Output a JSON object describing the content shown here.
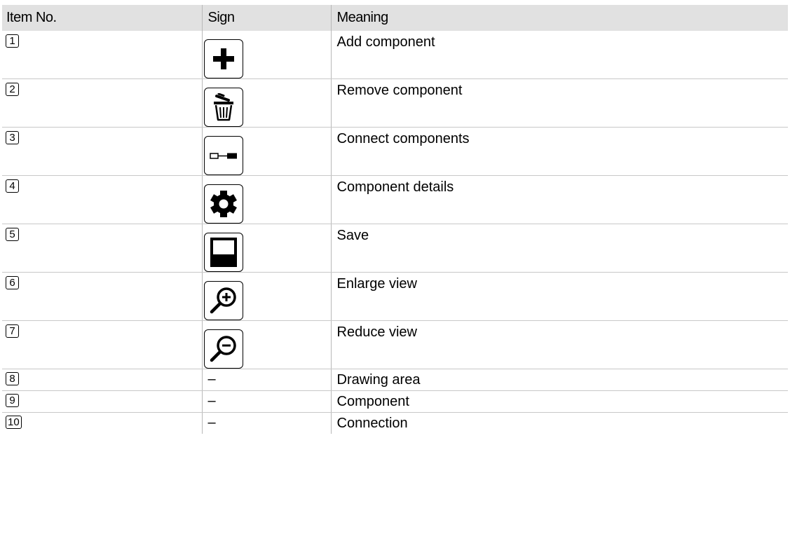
{
  "headers": {
    "item_no": "Item No.",
    "sign": "Sign",
    "meaning": "Meaning"
  },
  "rows": [
    {
      "item": "1",
      "sign_icon": "plus-icon",
      "meaning": "Add component"
    },
    {
      "item": "2",
      "sign_icon": "trash-icon",
      "meaning": "Remove component"
    },
    {
      "item": "3",
      "sign_icon": "connect-icon",
      "meaning": "Connect components"
    },
    {
      "item": "4",
      "sign_icon": "gear-icon",
      "meaning": "Component details"
    },
    {
      "item": "5",
      "sign_icon": "save-icon",
      "meaning": "Save"
    },
    {
      "item": "6",
      "sign_icon": "zoom-in-icon",
      "meaning": "Enlarge view"
    },
    {
      "item": "7",
      "sign_icon": "zoom-out-icon",
      "meaning": "Reduce view"
    },
    {
      "item": "8",
      "sign_text": "–",
      "meaning": "Drawing area"
    },
    {
      "item": "9",
      "sign_text": "–",
      "meaning": "Component"
    },
    {
      "item": "10",
      "sign_text": "–",
      "meaning": "Connection"
    }
  ]
}
